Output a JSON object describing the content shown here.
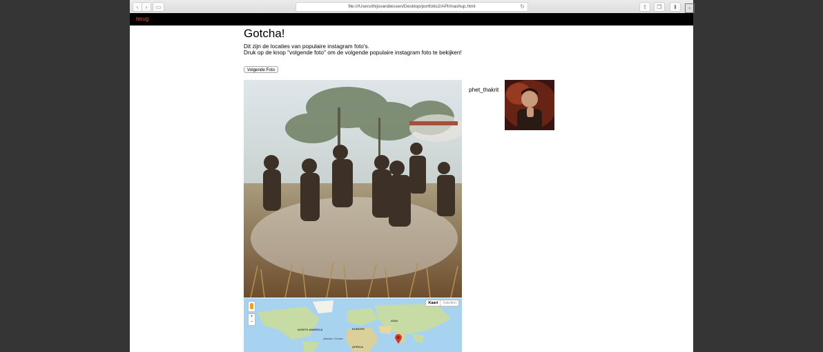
{
  "browser": {
    "url": "file:///Users/thijsvandiessen/Desktop/portfolio2/API/mashup.html"
  },
  "nav": {
    "back_link": "terug"
  },
  "page": {
    "title": "Gotcha!",
    "intro_line1": "Dit zijn de locaties van populaire instagram foto's.",
    "intro_line2": "Druk op de knop \"volgende foto\" om de volgende populaire instagram foto te bekijken!",
    "next_button": "Volgende Foto"
  },
  "post": {
    "username": "phet_thakrit"
  },
  "map": {
    "type_map": "Kaart",
    "type_satellite": "Satelliet",
    "labels": {
      "north_america": "NORTH AMERICA",
      "europe": "EUROPE",
      "asia": "ASIA",
      "africa": "AFRICA",
      "atlantic": "Atlantic Ocean"
    }
  },
  "colors": {
    "nav_link": "#e05a2a",
    "nav_bg": "#000000",
    "marker": "#d23a2a"
  }
}
